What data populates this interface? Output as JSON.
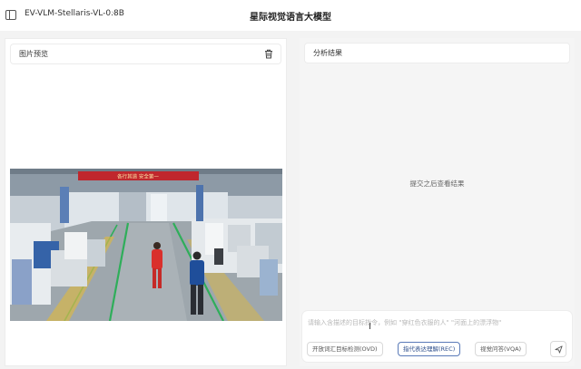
{
  "header": {
    "model_name": "EV-VLM-Stellaris-VL-0.8B",
    "app_title": "星际视觉语言大模型",
    "chevron_icon": "chevron-down-icon",
    "sidebar_icon": "sidebar-toggle-icon"
  },
  "left_panel": {
    "title": "图片预览",
    "delete_icon": "trash-icon",
    "banner_text": "各行其道 安全第一"
  },
  "right_panel": {
    "title": "分析结果",
    "empty_hint": "提交之后查看结果"
  },
  "prompt": {
    "placeholder": "请输入含描述的目标指令，例如 \"穿红色衣服的人\" \"河面上的漂浮物\"",
    "tasks": [
      {
        "label": "开放词汇目标检测(OVD)",
        "active": false
      },
      {
        "label": "指代表达理解(REC)",
        "active": true
      },
      {
        "label": "视觉问答(VQA)",
        "active": false
      }
    ],
    "send_icon": "send-icon"
  },
  "colors": {
    "accent": "#2e4f8c",
    "accent_border": "#5a7ab8",
    "banner_red": "#c0272d"
  }
}
